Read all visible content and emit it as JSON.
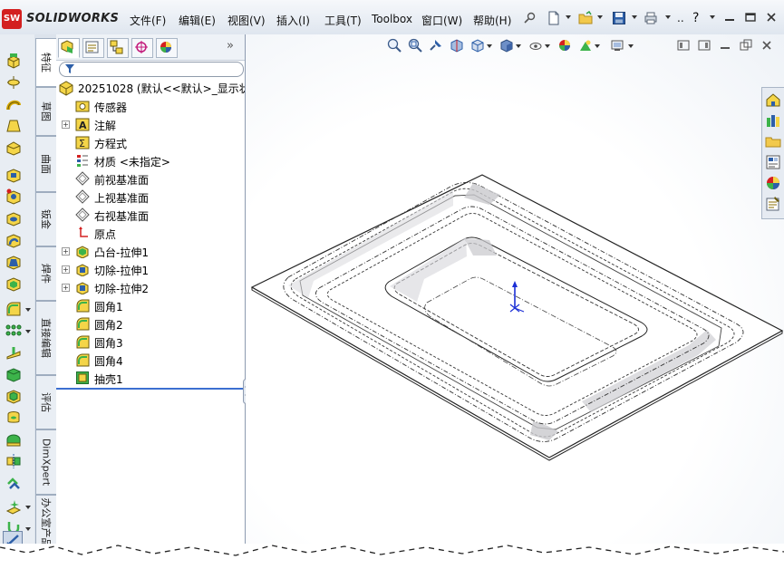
{
  "app": {
    "title": "SOLIDWORKS",
    "logo_badge": "SW"
  },
  "menu": [
    {
      "label": "文件(F)"
    },
    {
      "label": "编辑(E)"
    },
    {
      "label": "视图(V)"
    },
    {
      "label": "插入(I)"
    },
    {
      "label": "工具(T)"
    },
    {
      "label": "Toolbox"
    },
    {
      "label": "窗口(W)"
    },
    {
      "label": "帮助(H)"
    }
  ],
  "toolbar": {
    "icons": [
      "pin-icon",
      "new-document-icon",
      "open-icon",
      "save-icon",
      "print-icon",
      "dots-icon",
      "help-icon"
    ],
    "dots_label": "..",
    "help_label": "?"
  },
  "command_manager": {
    "tabs": [
      {
        "label": "特征",
        "active": true
      },
      {
        "label": "草图"
      },
      {
        "label": "曲面"
      },
      {
        "label": "钣金"
      },
      {
        "label": "焊件"
      },
      {
        "label": "直接编辑"
      },
      {
        "label": "评估"
      },
      {
        "label": "DimXpert"
      },
      {
        "label": "办公室产品"
      }
    ]
  },
  "feature_manager": {
    "tabs": [
      "featuremanager-tree-icon",
      "propertymanager-icon",
      "configurationmanager-icon",
      "dimxpertmanager-icon",
      "displaymanager-icon"
    ],
    "more_label": "»",
    "root": {
      "label": "20251028  (默认<<默认>_显示状"
    },
    "items": [
      {
        "label": "传感器",
        "icon": "sensor-icon",
        "expandable": false
      },
      {
        "label": "注解",
        "icon": "annotation-icon",
        "expandable": true
      },
      {
        "label": "方程式",
        "icon": "equation-icon",
        "expandable": false
      },
      {
        "label": "材质 <未指定>",
        "icon": "material-icon",
        "expandable": false
      },
      {
        "label": "前视基准面",
        "icon": "plane-icon",
        "expandable": false
      },
      {
        "label": "上视基准面",
        "icon": "plane-icon",
        "expandable": false
      },
      {
        "label": "右视基准面",
        "icon": "plane-icon",
        "expandable": false
      },
      {
        "label": "原点",
        "icon": "origin-icon",
        "expandable": false
      },
      {
        "label": "凸台-拉伸1",
        "icon": "boss-extrude-icon",
        "expandable": true
      },
      {
        "label": "切除-拉伸1",
        "icon": "cut-extrude-icon",
        "expandable": true
      },
      {
        "label": "切除-拉伸2",
        "icon": "cut-extrude-icon",
        "expandable": true
      },
      {
        "label": "圆角1",
        "icon": "fillet-icon",
        "expandable": false
      },
      {
        "label": "圆角2",
        "icon": "fillet-icon",
        "expandable": false
      },
      {
        "label": "圆角3",
        "icon": "fillet-icon",
        "expandable": false
      },
      {
        "label": "圆角4",
        "icon": "fillet-icon",
        "expandable": false
      },
      {
        "label": "抽壳1",
        "icon": "shell-icon",
        "expandable": false
      }
    ]
  },
  "heads_up_toolbar": {
    "icons": [
      "zoom-to-fit-icon",
      "zoom-to-area-icon",
      "previous-view-icon",
      "section-view-icon",
      "view-orientation-icon",
      "display-style-icon",
      "hide-show-icon",
      "edit-appearance-icon",
      "apply-scene-icon",
      "view-settings-icon"
    ]
  },
  "task_pane": {
    "icons": [
      "solidworks-resources-icon",
      "design-library-icon",
      "file-explorer-icon",
      "view-palette-icon",
      "appearances-icon",
      "custom-properties-icon"
    ]
  },
  "colors": {
    "accent": "#3c6fd1",
    "logo_red": "#d32020",
    "model_edge": "#222222"
  }
}
